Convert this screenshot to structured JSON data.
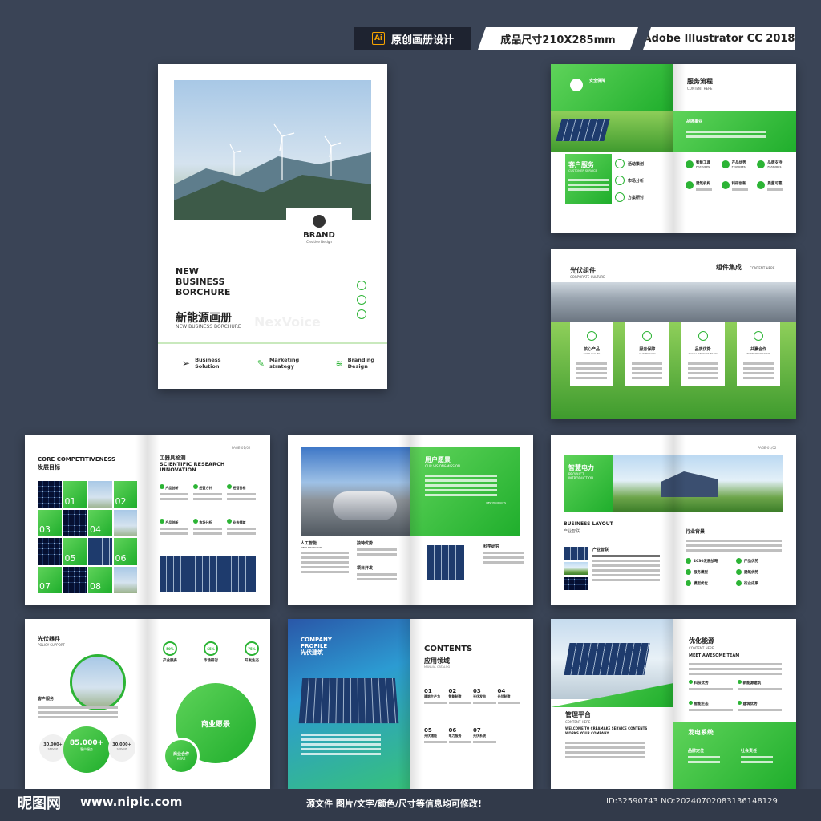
{
  "tags": {
    "design": "原创画册设计",
    "size": "成品尺寸210X285mm",
    "software": "Adobe Illustrator CC 2018",
    "ai_badge": "Ai"
  },
  "cover": {
    "brand": "BRAND",
    "brand_sub": "Creative Design",
    "title_line1": "NEW",
    "title_line2": "BUSINESS",
    "title_line3": "BORCHURE",
    "title_cn": "新能源画册",
    "title_en": "NEW BUSINESS BORCHURE",
    "watermark": "NexVoice",
    "footer_items": [
      {
        "line1": "Business",
        "line2": "Solution"
      },
      {
        "line1": "Marketing",
        "line2": "strategy"
      },
      {
        "line1": "Branding",
        "line2": "Design"
      }
    ]
  },
  "spread1": {
    "badge_title": "安全保障",
    "customer_service": "客户服务",
    "customer_service_en": "CUSTOMER SERVICE",
    "items": [
      "活动策划",
      "市场分析",
      "方案研讨"
    ],
    "right_title": "服务流程",
    "right_sub": "CONTENT HERE",
    "brand_label": "品牌事业",
    "grid": [
      "智能工具",
      "产品优势",
      "品牌支持",
      "建筑机构",
      "科研创新",
      "质量可靠"
    ],
    "grid_en": "FEATURES"
  },
  "spread2": {
    "title": "光伏组件",
    "subtitle": "CORPORATE CULTURE",
    "right_title": "组件集成",
    "right_sub": "CONTENT HERE",
    "cards": [
      {
        "title": "核心产品",
        "en": "CORE VALUES"
      },
      {
        "title": "服务保障",
        "en": "OUR MISSION"
      },
      {
        "title": "品质优势",
        "en": "SOCIAL RESPONSIBILITY"
      },
      {
        "title": "共赢合作",
        "en": "ENTERPRISE SPIRIT"
      }
    ]
  },
  "spread3": {
    "title_en": "CORE COMPETITIVENESS",
    "title_cn": "发展目标",
    "right_cn": "工器具检测",
    "right_en1": "SCIENTIFIC RESEARCH",
    "right_en2": "INNOVATION",
    "page": "PAGE-01/02",
    "numbers": [
      "01",
      "02",
      "03",
      "04",
      "05",
      "06",
      "07",
      "08"
    ],
    "labels": [
      "产品创新",
      "经营方针",
      "经营目标",
      "产品创新",
      "市场分析",
      "业务领域"
    ]
  },
  "spread4": {
    "vision_cn": "用户愿景",
    "vision_en": "OUR VISION&MISSION",
    "new_products": "NEW PRODUCTS",
    "labels": [
      "人工智能",
      "独特优势",
      "项目开发",
      "科学研究"
    ],
    "label_en": "NEW PRODUCTS"
  },
  "spread5": {
    "title": "智慧电力",
    "sub1": "PRODUCT",
    "sub2": "INTRODUCTION",
    "page": "PAGE-01/02",
    "layout_en": "BUSINESS LAYOUT",
    "layout_cn": "产业智联",
    "item": "产业智联",
    "right_title": "行业背景",
    "list": [
      "2030发展战略",
      "产品优势",
      "服务模型",
      "建筑优势",
      "模型优化",
      "行业成果"
    ]
  },
  "spread6": {
    "title": "光伏器件",
    "subtitle": "POLICY SUPPORT",
    "customer": "客户服务",
    "percents": [
      "50%",
      "65%",
      "75%"
    ],
    "percent_labels": [
      "产业服务",
      "市场研讨",
      "开发生态"
    ],
    "stat_main": "85.000+",
    "stat_main_label": "客户服务",
    "stat_side": "30.000+",
    "stat_side_label": "SERVICE",
    "big_circle": "商业愿景",
    "small_circle1": "商业合作",
    "small_circle2": "HERE"
  },
  "spread7": {
    "profile1": "COMPANY",
    "profile2": "PROFILE",
    "profile_cn": "光伏建筑",
    "contents": "CONTENTS",
    "contents_cn": "应用领域",
    "contents_sub": "MANUAL CATALOG",
    "toc": [
      {
        "num": "01",
        "label": "建筑生产力"
      },
      {
        "num": "02",
        "label": "智能制造"
      },
      {
        "num": "03",
        "label": "光伏发电"
      },
      {
        "num": "04",
        "label": "光伏制造"
      },
      {
        "num": "05",
        "label": "光伏储能"
      },
      {
        "num": "06",
        "label": "电力服务"
      },
      {
        "num": "07",
        "label": "光伏系统"
      }
    ]
  },
  "spread8": {
    "title": "优化能源",
    "sub1": "CONTENT HERE",
    "sub2": "MEET AWESOME TEAM",
    "bullets": [
      "科技优势",
      "新能源建筑",
      "智能生态",
      "建筑优势"
    ],
    "platform": "管理平台",
    "platform_sub": "CONTENT HERE",
    "welcome1": "WELCOME TO CREAMAKE SERVICE CONTENTS",
    "welcome2": "WORKS YOUR COMPANY",
    "power": "发电系统",
    "power_items": [
      "品牌定位",
      "社会责任"
    ]
  },
  "footer": {
    "logo": "昵图网",
    "url": "www.nipic.com",
    "center": "源文件 图片/文字/颜色/尺寸等信息均可修改!",
    "id": "ID:32590743 NO:20240702083136148129"
  }
}
